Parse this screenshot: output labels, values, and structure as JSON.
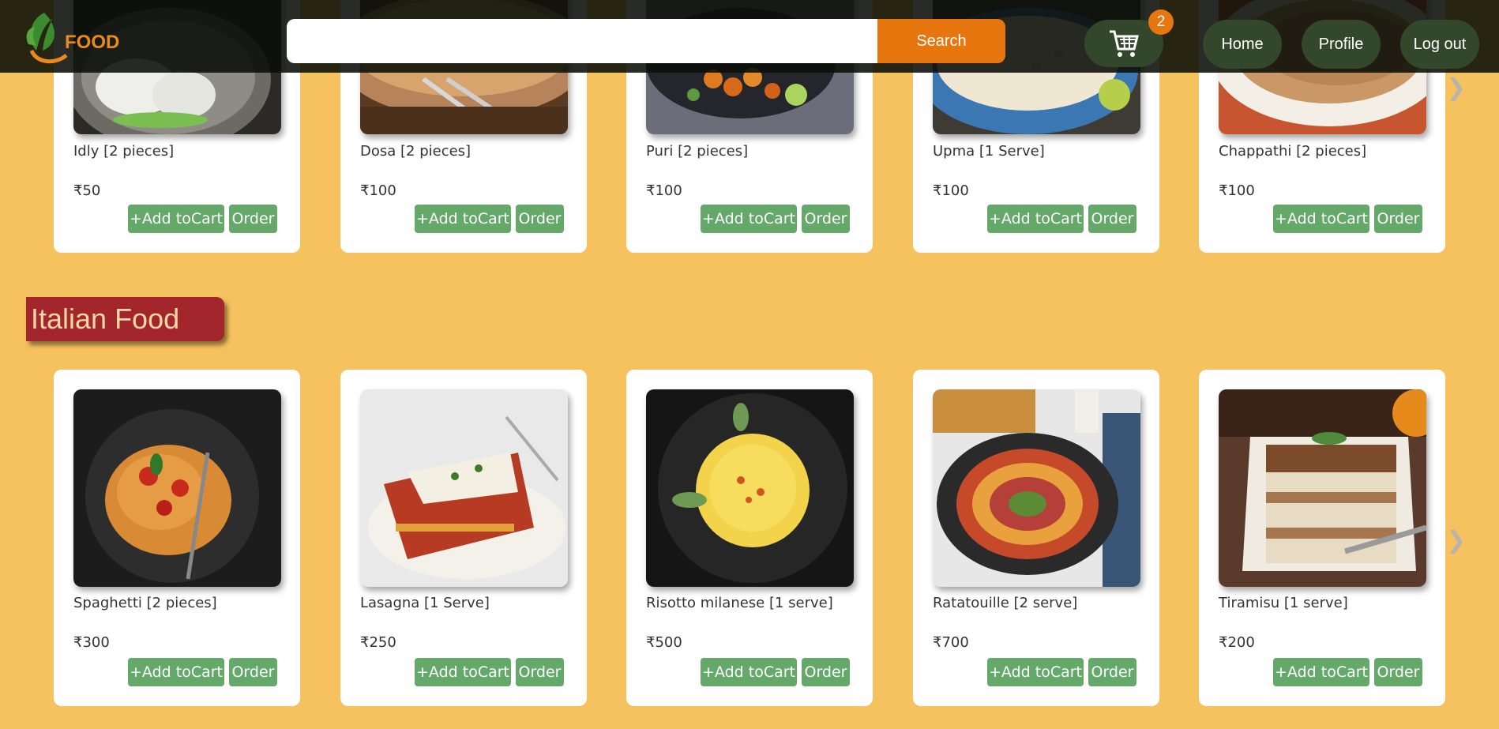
{
  "header": {
    "logo_text": "FOOD",
    "search": {
      "value": "",
      "placeholder": ""
    },
    "search_button": "Search",
    "cart_count": "2",
    "nav": {
      "home": "Home",
      "profile": "Profile",
      "logout": "Log out"
    }
  },
  "icons": {
    "logo": "leaf-logo-icon",
    "cart": "shopping-cart-icon",
    "prev": "chevron-left-double-icon",
    "next": "chevron-right-double-icon"
  },
  "colors": {
    "page_bg": "#f6c25f",
    "header_bg": "#0a0e08",
    "accent_orange": "#e8760f",
    "nav_green": "#33472a",
    "button_green": "#64a86a",
    "section_title_bg": "#a3262c",
    "section_title_text": "#f7d7a6"
  },
  "arrows": {
    "prev": "❮❮",
    "next": "❯❯"
  },
  "south_indian": {
    "items": [
      {
        "name": "Idly [2 pieces]",
        "price": "₹50",
        "add_label": "+Add toCart",
        "order_label": "Order"
      },
      {
        "name": "Dosa [2 pieces]",
        "price": "₹100",
        "add_label": "+Add toCart",
        "order_label": "Order"
      },
      {
        "name": "Puri [2 pieces]",
        "price": "₹100",
        "add_label": "+Add toCart",
        "order_label": "Order"
      },
      {
        "name": "Upma [1 Serve]",
        "price": "₹100",
        "add_label": "+Add toCart",
        "order_label": "Order"
      },
      {
        "name": "Chappathi [2 pieces]",
        "price": "₹100",
        "add_label": "+Add toCart",
        "order_label": "Order"
      }
    ]
  },
  "italian": {
    "title": "Italian Food",
    "items": [
      {
        "name": "Spaghetti [2 pieces]",
        "price": "₹300",
        "add_label": "+Add toCart",
        "order_label": "Order"
      },
      {
        "name": "Lasagna [1 Serve]",
        "price": "₹250",
        "add_label": "+Add toCart",
        "order_label": "Order"
      },
      {
        "name": "Risotto milanese [1 serve]",
        "price": "₹500",
        "add_label": "+Add toCart",
        "order_label": "Order"
      },
      {
        "name": "Ratatouille [2 serve]",
        "price": "₹700",
        "add_label": "+Add toCart",
        "order_label": "Order"
      },
      {
        "name": "Tiramisu [1 serve]",
        "price": "₹200",
        "add_label": "+Add toCart",
        "order_label": "Order"
      }
    ]
  }
}
